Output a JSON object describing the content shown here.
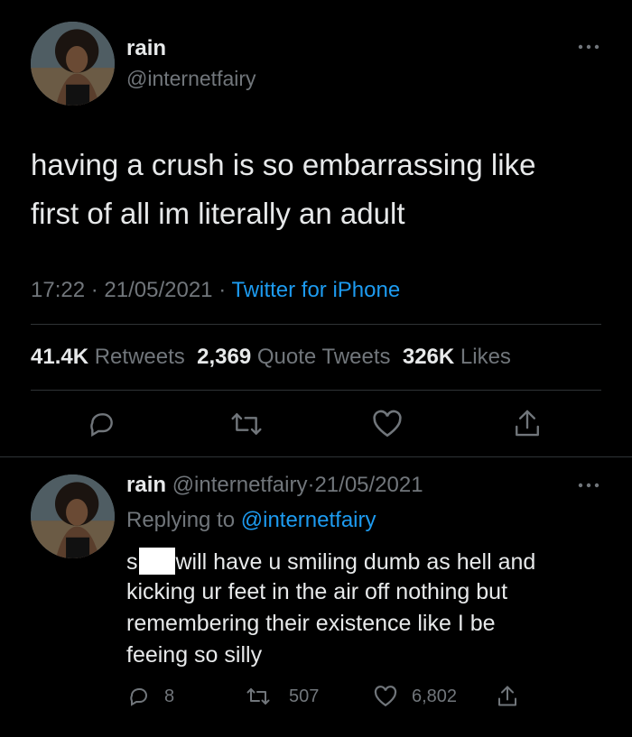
{
  "tweet": {
    "display_name": "rain",
    "handle": "@internetfairy",
    "text_line1": "having a crush is so embarrassing like",
    "text_line2": "first of all im literally an adult",
    "time": "17:22",
    "date": "21/05/2021",
    "separator": "·",
    "source": "Twitter for iPhone",
    "stats": {
      "retweets_count": "41.4K",
      "retweets_label": "Retweets",
      "quotes_count": "2,369",
      "quotes_label": "Quote Tweets",
      "likes_count": "326K",
      "likes_label": "Likes"
    },
    "actions": [
      "reply-icon",
      "retweet-icon",
      "like-icon",
      "share-icon"
    ],
    "more_icon": "more-icon"
  },
  "reply": {
    "display_name": "rain",
    "handle": "@internetfairy",
    "separator": "·",
    "date": "21/05/2021",
    "replying_prefix": "Replying to",
    "replying_handle": "@internetfairy",
    "text_start": "s",
    "text_line1_rest": "will have u smiling dumb as hell and",
    "text_line2": "kicking ur feet in the air off nothing but",
    "text_line3": "remembering their existence like I be",
    "text_line4": "feeing so silly",
    "reply_count": "8",
    "retweet_count": "507",
    "like_count": "6,802"
  },
  "colors": {
    "background": "#000000",
    "text": "#e7e9ea",
    "muted": "#71767b",
    "link": "#1d9bf0",
    "divider": "#2f3336"
  }
}
